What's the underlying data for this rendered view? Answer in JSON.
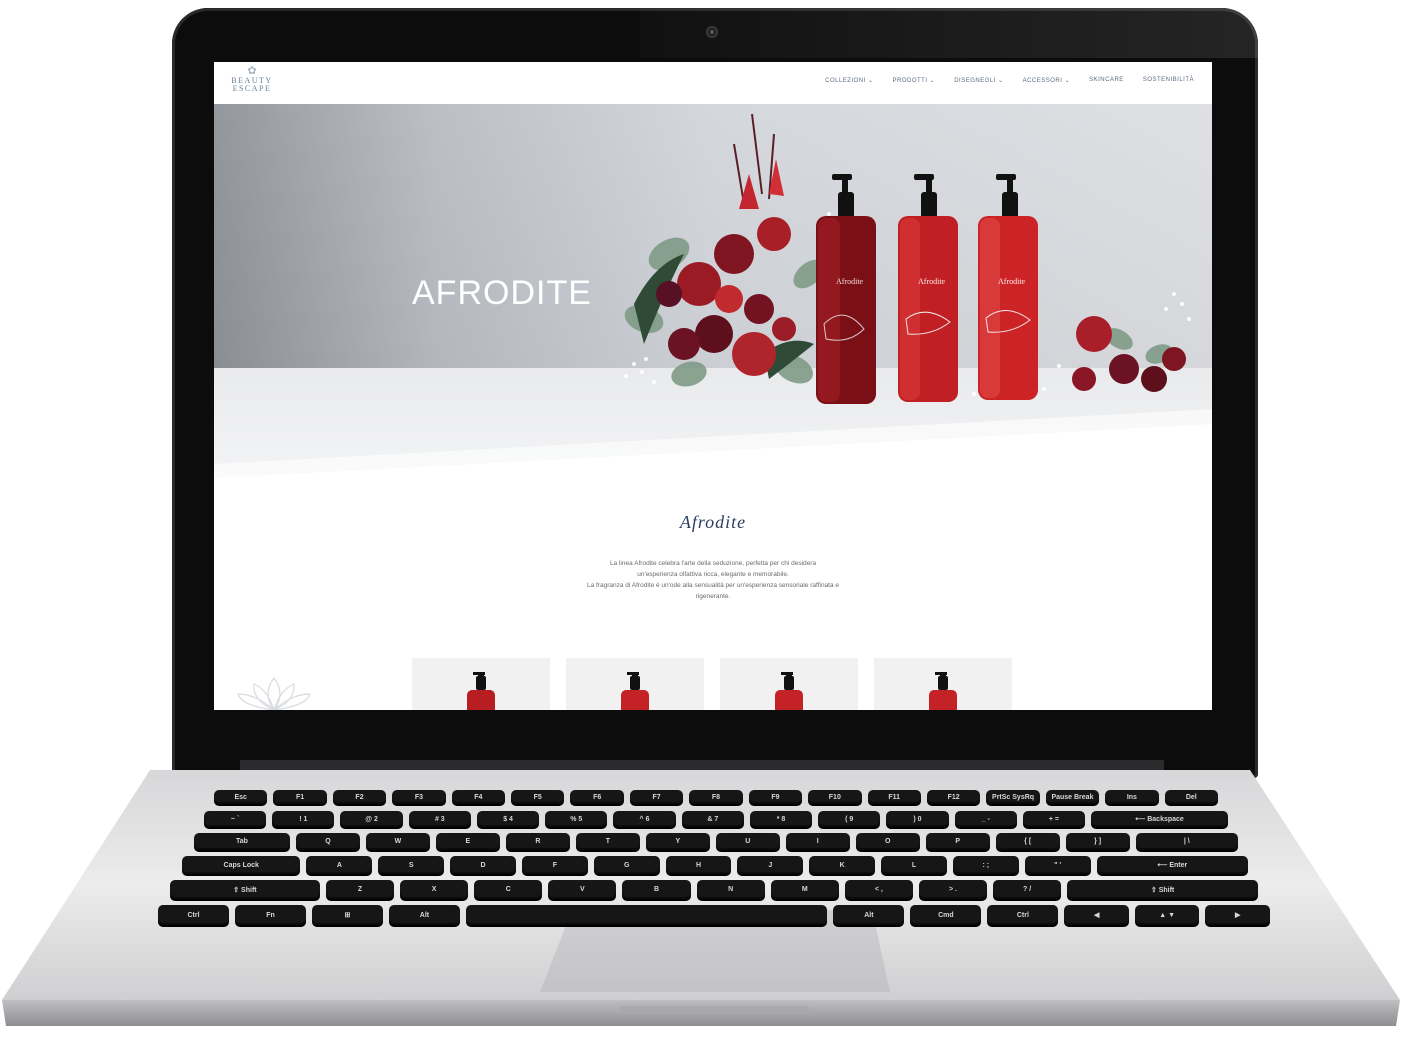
{
  "site": {
    "logo_line1": "BEAUTY",
    "logo_line2": "ESCAPE",
    "nav": [
      {
        "label": "COLLEZIONI ⌄"
      },
      {
        "label": "PRODOTTI ⌄"
      },
      {
        "label": "DISEGNEGLI ⌄"
      },
      {
        "label": "ACCESSORI ⌄"
      },
      {
        "label": "SKINCARE"
      },
      {
        "label": "SOSTENIBILITÀ"
      }
    ],
    "hero_title": "AFRODITE",
    "bottle_label": "Afrodite",
    "intro_title": "Afrodite",
    "intro_lines": [
      "La linea Afrodite celebra l'arte della seduzione, perfetta per chi desidera",
      "un'esperienza olfattiva ricca, elegante e memorabile.",
      "La fragranza di Afrodite è un'ode alla sensualità per un'esperienza sensoriale raffinata e",
      "rigenerante."
    ]
  },
  "keyboard": {
    "row1": [
      "Esc",
      "F1",
      "F2",
      "F3",
      "F4",
      "F5",
      "F6",
      "F7",
      "F8",
      "F9",
      "F10",
      "F11",
      "F12",
      "PrtSc SysRq",
      "Pause Break",
      "Ins",
      "Del"
    ],
    "row2": [
      "~ `",
      "! 1",
      "@ 2",
      "# 3",
      "$ 4",
      "% 5",
      "^ 6",
      "& 7",
      "* 8",
      "( 9",
      ") 0",
      "_ -",
      "+ =",
      "⟵ Backspace"
    ],
    "row3": [
      "Tab",
      "Q",
      "W",
      "E",
      "R",
      "T",
      "Y",
      "U",
      "I",
      "O",
      "P",
      "{ [",
      "} ]",
      "| \\"
    ],
    "row4": [
      "Caps Lock",
      "A",
      "S",
      "D",
      "F",
      "G",
      "H",
      "J",
      "K",
      "L",
      ": ;",
      "\" '",
      "⟵ Enter"
    ],
    "row5": [
      "⇧ Shift",
      "Z",
      "X",
      "C",
      "V",
      "B",
      "N",
      "M",
      "< ,",
      "> .",
      "? /",
      "⇧ Shift"
    ],
    "row6": [
      "Ctrl",
      "Fn",
      "⊞",
      "Alt",
      "",
      "Alt",
      "Cmd",
      "Ctrl",
      "◀",
      "▲ ▼",
      "▶"
    ]
  }
}
